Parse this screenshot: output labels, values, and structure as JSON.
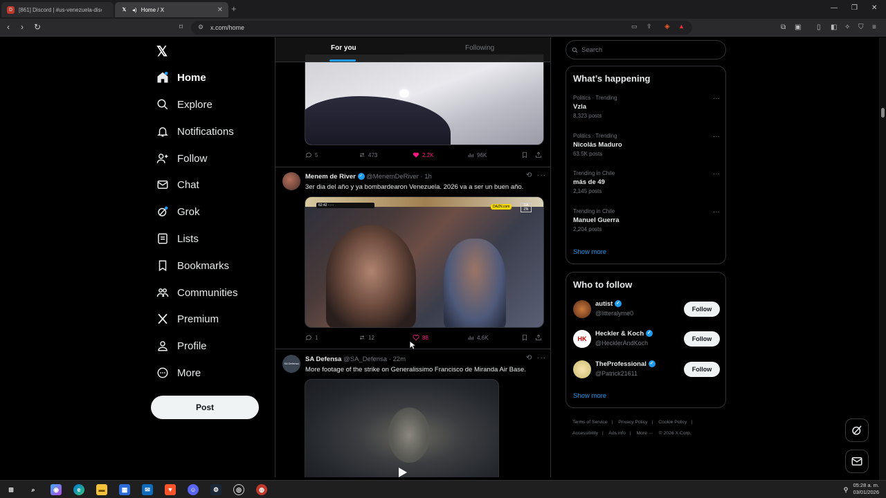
{
  "browser": {
    "tabs": [
      {
        "title": "[861] Discord | #us-venezuela-disc",
        "active": false
      },
      {
        "title": "Home / X",
        "active": true
      }
    ],
    "url": "x.com/home"
  },
  "nav": {
    "items": [
      {
        "label": "Home",
        "icon": "home-icon",
        "active": true
      },
      {
        "label": "Explore",
        "icon": "search-icon"
      },
      {
        "label": "Notifications",
        "icon": "bell-icon"
      },
      {
        "label": "Follow",
        "icon": "person-plus-icon"
      },
      {
        "label": "Chat",
        "icon": "mail-icon"
      },
      {
        "label": "Grok",
        "icon": "grok-icon"
      },
      {
        "label": "Lists",
        "icon": "list-icon"
      },
      {
        "label": "Bookmarks",
        "icon": "bookmark-icon"
      },
      {
        "label": "Communities",
        "icon": "people-icon"
      },
      {
        "label": "Premium",
        "icon": "x-icon"
      },
      {
        "label": "Profile",
        "icon": "person-icon"
      },
      {
        "label": "More",
        "icon": "more-circle-icon"
      }
    ],
    "post_label": "Post"
  },
  "feed": {
    "tabs": {
      "for_you": "For you",
      "following": "Following"
    },
    "tweet0": {
      "replies": "5",
      "reposts": "473",
      "likes": "2.2K",
      "views": "96K"
    },
    "tweet1": {
      "name": "Menem de River",
      "handle": "@MenemDeRiver · 1h",
      "text": "3er dia del año y ya bombardearon Venezuela. 2026 va a ser un buen año.",
      "media_badge": "DAZN.com",
      "replies": "1",
      "reposts": "12",
      "likes": "88",
      "views": "4.6K"
    },
    "tweet2": {
      "name": "SA Defensa",
      "handle": "@SA_Defensa · 22m",
      "text": "More footage of the strike on Generalissimo Francisco de Miranda Air Base.",
      "avatar_text": "SA Defensa"
    }
  },
  "search": {
    "placeholder": "Search"
  },
  "happening": {
    "title": "What’s happening",
    "trends": [
      {
        "context": "Politics · Trending",
        "title": "Vzla",
        "count": "8,323 posts"
      },
      {
        "context": "Politics · Trending",
        "title": "Nicolás Maduro",
        "count": "63.5K posts"
      },
      {
        "context": "Trending in Chile",
        "title": "más de 49",
        "count": "2,145 posts"
      },
      {
        "context": "Trending in Chile",
        "title": "Manuel Guerra",
        "count": "2,204 posts"
      }
    ],
    "show_more": "Show more"
  },
  "who_to_follow": {
    "title": "Who to follow",
    "accounts": [
      {
        "name": "autist",
        "handle": "@litteralyme0",
        "button": "Follow"
      },
      {
        "name": "Heckler & Koch",
        "handle": "@HecklerAndKoch",
        "button": "Follow"
      },
      {
        "name": "TheProfessional",
        "handle": "@Patrick21611",
        "button": "Follow"
      }
    ],
    "show_more": "Show more"
  },
  "footer": {
    "links": [
      "Terms of Service",
      "Privacy Policy",
      "Cookie Policy",
      "Accessibility",
      "Ads info",
      "More ···",
      "© 2026 X Corp."
    ]
  },
  "taskbar": {
    "time": "05:28 a. m.",
    "date": "03/01/2026"
  },
  "colors": {
    "accent": "#1d9bf0",
    "like": "#f91880"
  }
}
